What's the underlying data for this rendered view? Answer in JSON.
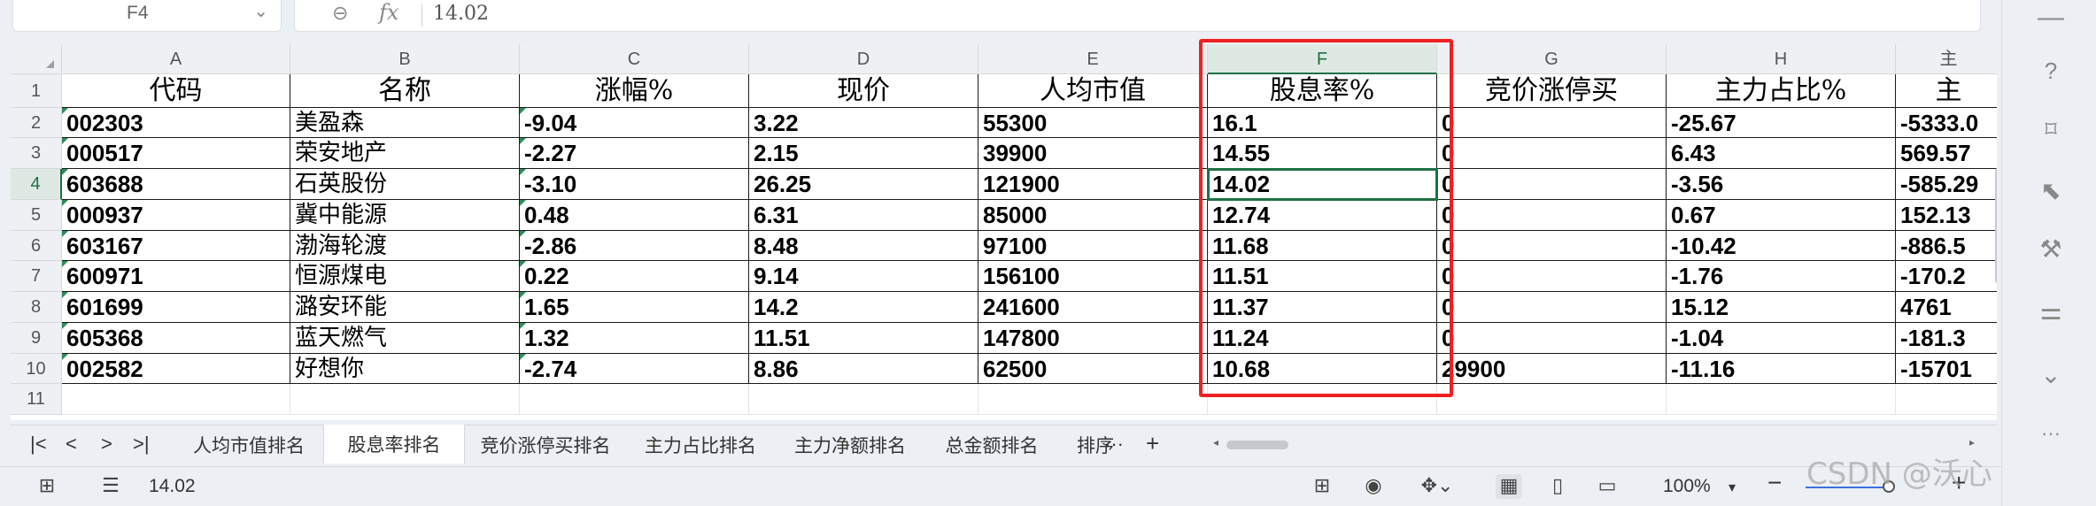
{
  "formula_bar": {
    "cell_ref": "F4",
    "fx_label": "fx",
    "value": "14.02"
  },
  "columns": [
    "A",
    "B",
    "C",
    "D",
    "E",
    "F",
    "G",
    "H",
    "主"
  ],
  "rows": [
    "1",
    "2",
    "3",
    "4",
    "5",
    "6",
    "7",
    "8",
    "9",
    "10",
    "11"
  ],
  "table": {
    "headers": [
      "代码",
      "名称",
      "涨幅%",
      "现价",
      "人均市值",
      "股息率%",
      "竞价涨停买",
      "主力占比%",
      "主"
    ],
    "rows": [
      [
        "002303",
        "美盈森",
        "-9.04",
        "3.22",
        "55300",
        "16.1",
        "0",
        "-25.67",
        "-5333.0"
      ],
      [
        "000517",
        "荣安地产",
        "-2.27",
        "2.15",
        "39900",
        "14.55",
        "0",
        "6.43",
        "569.57"
      ],
      [
        "603688",
        "石英股份",
        "-3.10",
        "26.25",
        "121900",
        "14.02",
        "0",
        "-3.56",
        "-585.29"
      ],
      [
        "000937",
        "冀中能源",
        "0.48",
        "6.31",
        "85000",
        "12.74",
        "0",
        "0.67",
        "152.13"
      ],
      [
        "603167",
        "渤海轮渡",
        "-2.86",
        "8.48",
        "97100",
        "11.68",
        "0",
        "-10.42",
        "-886.5"
      ],
      [
        "600971",
        "恒源煤电",
        "0.22",
        "9.14",
        "156100",
        "11.51",
        "0",
        "-1.76",
        "-170.2"
      ],
      [
        "601699",
        "潞安环能",
        "1.65",
        "14.2",
        "241600",
        "11.37",
        "0",
        "15.12",
        "4761"
      ],
      [
        "605368",
        "蓝天燃气",
        "1.32",
        "11.51",
        "147800",
        "11.24",
        "0",
        "-1.04",
        "-181.3"
      ],
      [
        "002582",
        "好想你",
        "-2.74",
        "8.86",
        "62500",
        "10.68",
        "29900",
        "-11.16",
        "-15701"
      ]
    ]
  },
  "sheet_tabs": [
    "人均市值排名",
    "股息率排名",
    "竞价涨停买排名",
    "主力占比排名",
    "主力净额排名",
    "总金额排名",
    "排序"
  ],
  "active_tab": "股息率排名",
  "nav": {
    "first": "|<",
    "prev": "<",
    "next": ">",
    "last": ">|",
    "more": "···",
    "add": "+"
  },
  "status": {
    "cell_value": "14.02",
    "zoom": "100%",
    "zoom_caret": "▾"
  },
  "watermark": "CSDN @沃心"
}
